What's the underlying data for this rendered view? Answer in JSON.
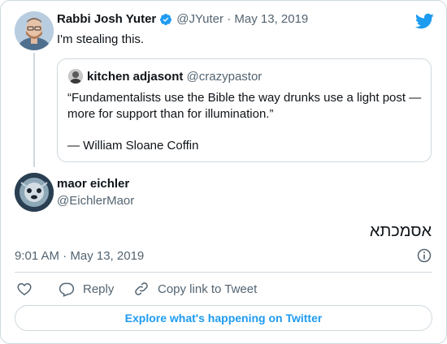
{
  "tweet": {
    "author_name": "Rabbi Josh Yuter",
    "author_handle": "@JYuter",
    "date": "May 13, 2019",
    "text": "I'm stealing this."
  },
  "quoted": {
    "author_name": "kitchen adjasont",
    "author_handle": "@crazypastor",
    "text": "“Fundamentalists use the Bible the way drunks use a light post — more for support than for illumination.”",
    "attribution": "— William Sloane Coffin"
  },
  "reply": {
    "author_name": "maor eichler",
    "author_handle": "@EichlerMaor",
    "text": "אסמכתא",
    "timestamp": "9:01 AM · May 13, 2019"
  },
  "actions": {
    "reply_label": "Reply",
    "copy_label": "Copy link to Tweet"
  },
  "explore_label": "Explore what's happening on Twitter",
  "colors": {
    "accent": "#1d9bf0",
    "muted": "#536471",
    "border": "#cfd9de"
  },
  "icons": [
    "verified-icon",
    "twitter-bird-icon",
    "info-icon",
    "heart-icon",
    "reply-icon",
    "link-icon"
  ]
}
